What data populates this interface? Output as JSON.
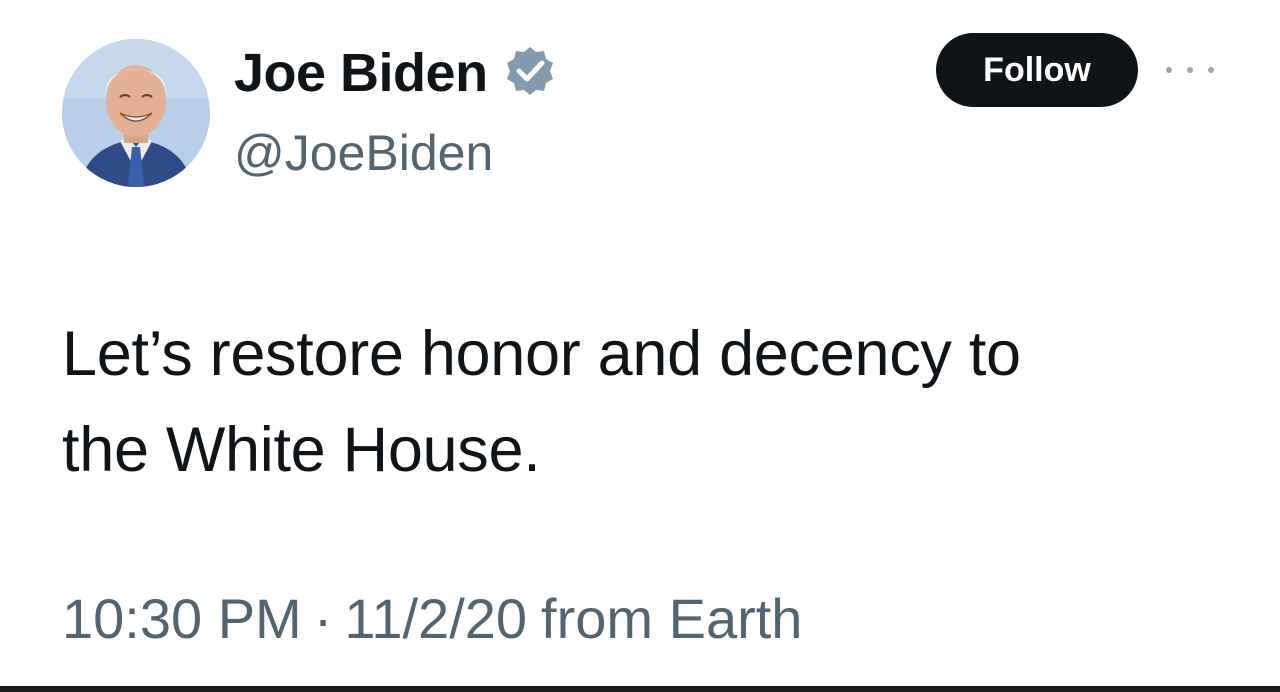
{
  "author": {
    "display_name": "Joe Biden",
    "handle": "@JoeBiden",
    "verified_icon": "verified-badge-icon",
    "avatar_icon": "profile-photo"
  },
  "actions": {
    "follow_label": "Follow",
    "more_icon": "more-options-icon"
  },
  "tweet": {
    "text_lines": [
      "Let’s restore honor and decency to",
      "the White House."
    ]
  },
  "meta": {
    "time": "10:30 PM",
    "separator": "·",
    "date": "11/2/20",
    "source": "from Earth"
  },
  "colors": {
    "text_primary": "#0f1419",
    "text_secondary": "#536471",
    "follow_bg": "#0f1419",
    "verified_badge": "#829aab"
  }
}
